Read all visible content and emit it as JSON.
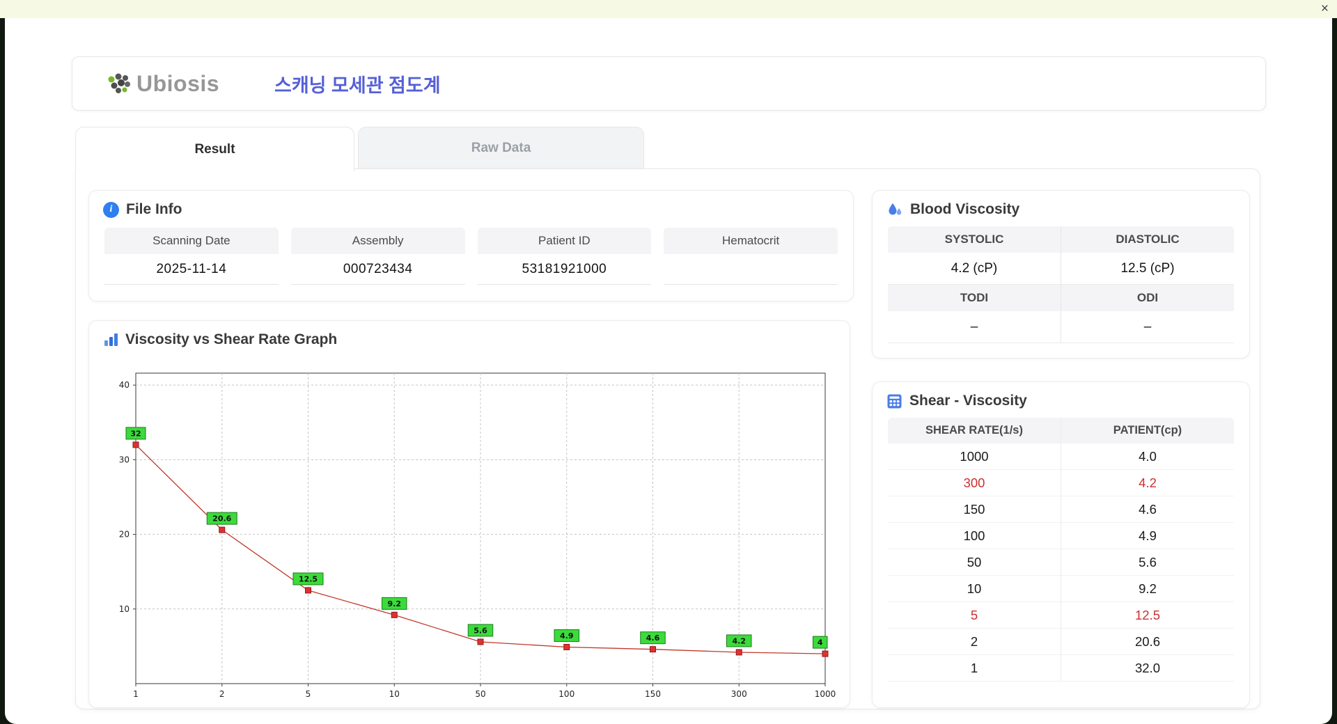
{
  "window": {
    "close_label": "×"
  },
  "header": {
    "logo_text": "Ubiosis",
    "title": "스캐닝 모세관 점도계"
  },
  "tabs": [
    {
      "label": "Result"
    },
    {
      "label": "Raw Data"
    }
  ],
  "file_info": {
    "title": "File Info",
    "fields": [
      {
        "label": "Scanning Date",
        "value": "2025-11-14"
      },
      {
        "label": "Assembly",
        "value": "000723434"
      },
      {
        "label": "Patient ID",
        "value": "53181921000"
      },
      {
        "label": "Hematocrit",
        "value": ""
      }
    ]
  },
  "blood_viscosity": {
    "title": "Blood Viscosity",
    "sections": [
      {
        "headers": [
          "SYSTOLIC",
          "DIASTOLIC"
        ],
        "values": [
          "4.2 (cP)",
          "12.5 (cP)"
        ]
      },
      {
        "headers": [
          "TODI",
          "ODI"
        ],
        "values": [
          "–",
          "–"
        ]
      }
    ]
  },
  "shear_viscosity": {
    "title": "Shear - Viscosity",
    "columns": [
      "SHEAR RATE(1/s)",
      "PATIENT(cp)"
    ],
    "rows": [
      {
        "rate": "1000",
        "patient": "4.0",
        "highlight": false
      },
      {
        "rate": "300",
        "patient": "4.2",
        "highlight": true
      },
      {
        "rate": "150",
        "patient": "4.6",
        "highlight": false
      },
      {
        "rate": "100",
        "patient": "4.9",
        "highlight": false
      },
      {
        "rate": "50",
        "patient": "5.6",
        "highlight": false
      },
      {
        "rate": "10",
        "patient": "9.2",
        "highlight": false
      },
      {
        "rate": "5",
        "patient": "12.5",
        "highlight": true
      },
      {
        "rate": "2",
        "patient": "20.6",
        "highlight": false
      },
      {
        "rate": "1",
        "patient": "32.0",
        "highlight": false
      }
    ]
  },
  "chart_data": {
    "type": "line",
    "title": "Viscosity vs Shear Rate Graph",
    "categories": [
      "1",
      "2",
      "5",
      "10",
      "50",
      "100",
      "150",
      "300",
      "1000"
    ],
    "values": [
      32,
      20.6,
      12.5,
      9.2,
      5.6,
      4.9,
      4.6,
      4.2,
      4
    ],
    "point_labels": [
      "32",
      "20.6",
      "12.5",
      "9.2",
      "5.6",
      "4.9",
      "4.6",
      "4.2",
      "4"
    ],
    "xlabel": "",
    "ylabel": "",
    "yticks": [
      10,
      20,
      30,
      40
    ],
    "ylim": [
      0,
      41.6
    ],
    "grid": true,
    "legend": false,
    "line_color": "#c0392b",
    "marker_color": "#e03131",
    "marker_border": "#8e1c1c",
    "label_bg": "#3bdb3b",
    "label_border": "#1d7a1d"
  },
  "colors": {
    "title_accent": "#5560d6",
    "icon_blue": "#2f6fe0",
    "highlight_red": "#cf2e2e",
    "header_gray_bg": "#f4f4f6",
    "titlebar_bg": "#f6f9e4",
    "desktop_bg": "#10180f",
    "logo_green": "#76b82a"
  }
}
